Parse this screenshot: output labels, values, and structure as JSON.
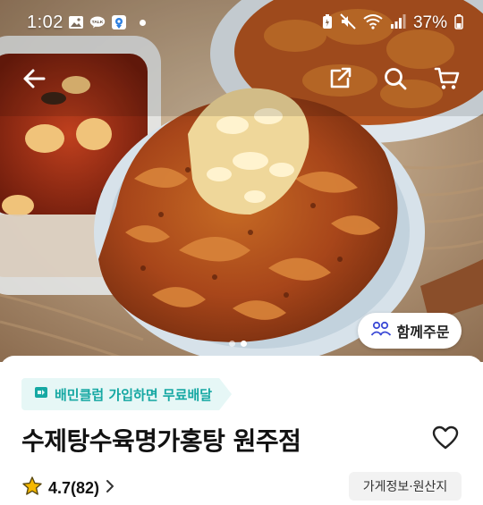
{
  "status_bar": {
    "time": "1:02",
    "battery": "37%",
    "left_icons": [
      "gallery-icon",
      "talk-icon",
      "maps-icon",
      "dot-icon"
    ],
    "right_icons": [
      "battery-saver-icon",
      "mute-icon",
      "wifi-icon",
      "signal-icon"
    ]
  },
  "header": {
    "icons": [
      "back-arrow-icon",
      "share-icon",
      "search-icon",
      "cart-icon"
    ]
  },
  "hero": {
    "group_order_label": "함께주문",
    "pager": {
      "count": 2,
      "active": 1
    }
  },
  "store": {
    "club_badge": "배민클럽 가입하면 무료배달",
    "name": "수제탕수육명가홍탕 원주점",
    "rating": "4.7(82)",
    "info_button": "가게정보·원산지"
  },
  "colors": {
    "accent": "#16a8a3",
    "badge_bg": "#e6f7f6",
    "star": "#f5b800"
  }
}
